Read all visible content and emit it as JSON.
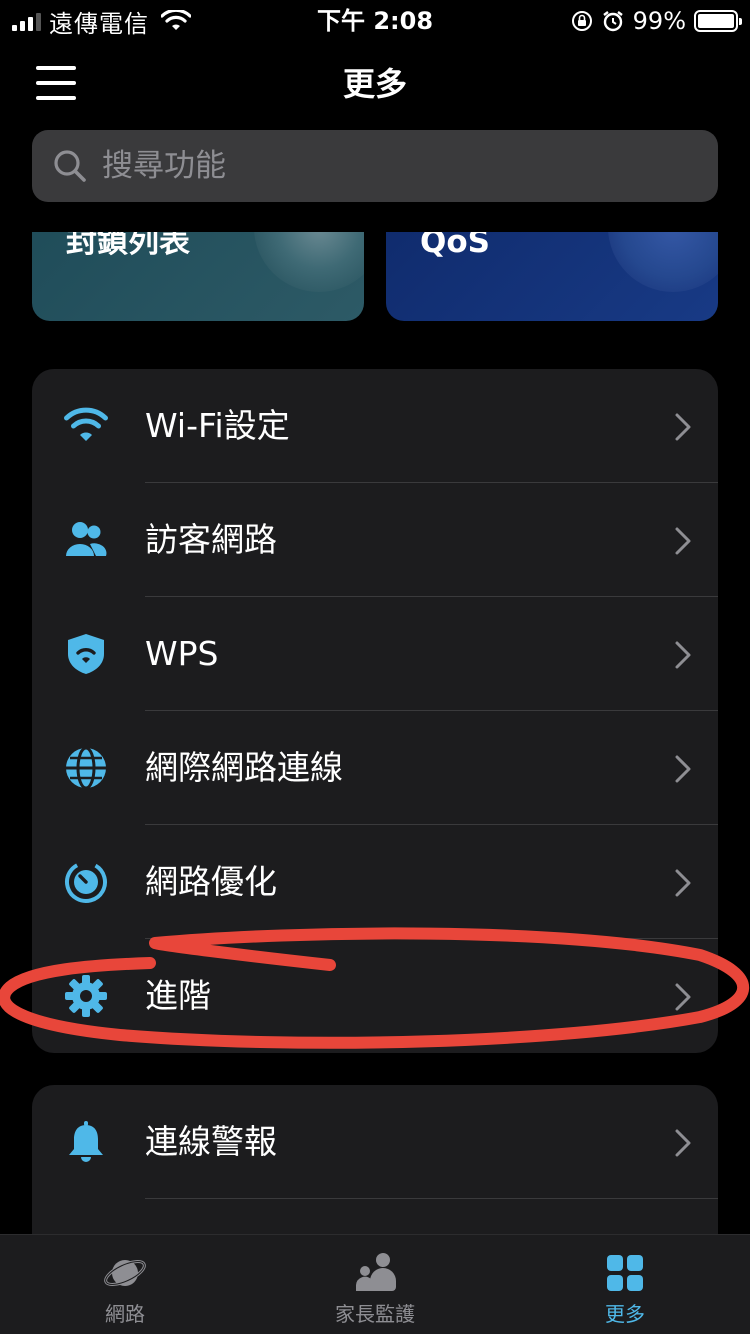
{
  "status_bar": {
    "carrier": "遠傳電信",
    "time": "下午 2:08",
    "battery_percent": "99%",
    "battery_level": 0.99
  },
  "nav": {
    "title": "更多"
  },
  "search": {
    "placeholder": "搜尋功能"
  },
  "feature_cards": [
    {
      "label": "封鎖列表"
    },
    {
      "label": "QoS"
    }
  ],
  "menu_group1": [
    {
      "label": "Wi-Fi設定",
      "icon": "wifi-icon"
    },
    {
      "label": "訪客網路",
      "icon": "guest-users-icon"
    },
    {
      "label": "WPS",
      "icon": "wps-shield-icon"
    },
    {
      "label": "網際網路連線",
      "icon": "globe-icon"
    },
    {
      "label": "網路優化",
      "icon": "speedometer-icon"
    },
    {
      "label": "進階",
      "icon": "gear-icon"
    }
  ],
  "menu_group2": [
    {
      "label": "連線警報",
      "icon": "bell-icon"
    }
  ],
  "tabbar": {
    "tabs": [
      {
        "label": "網路",
        "icon": "planet-icon",
        "active": false
      },
      {
        "label": "家長監護",
        "icon": "family-icon",
        "active": false
      },
      {
        "label": "更多",
        "icon": "grid-icon",
        "active": true
      }
    ]
  },
  "colors": {
    "accent": "#4fb8e8",
    "annotation": "#e8463a",
    "background": "#000000",
    "group_bg": "#1c1c1e"
  }
}
